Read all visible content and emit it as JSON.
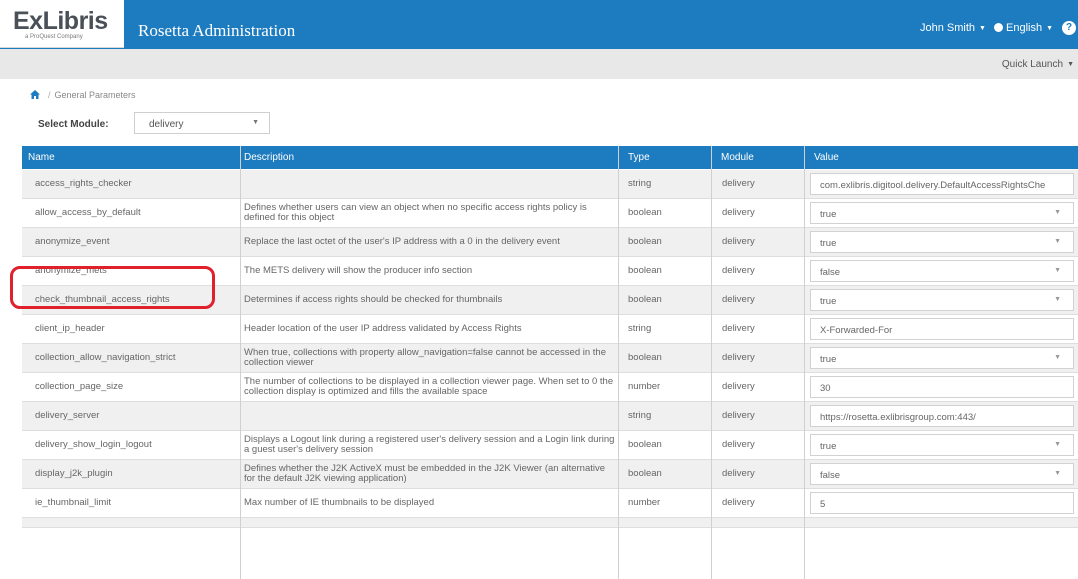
{
  "header": {
    "logo_text": "ExLibris",
    "logo_subtitle": "a ProQuest Company",
    "app_title": "Rosetta Administration",
    "user_menu": "John Smith",
    "language_menu": "English",
    "help_label": "?"
  },
  "quick_launch": {
    "label": "Quick Launch"
  },
  "breadcrumb": {
    "page": "General Parameters"
  },
  "module_select": {
    "label": "Select Module:",
    "value": "delivery"
  },
  "table": {
    "columns": [
      "Name",
      "Description",
      "Type",
      "Module",
      "Value"
    ],
    "rows": [
      {
        "name": "access_rights_checker",
        "description": "",
        "type": "string",
        "module": "delivery",
        "value": "com.exlibris.digitool.delivery.DefaultAccessRightsChe",
        "control": "text"
      },
      {
        "name": "allow_access_by_default",
        "description": "Defines whether users can view an object when no specific access rights policy is defined for this object",
        "type": "boolean",
        "module": "delivery",
        "value": "true",
        "control": "select"
      },
      {
        "name": "anonymize_event",
        "description": "Replace the last octet of the user's IP address with a 0 in the delivery event",
        "type": "boolean",
        "module": "delivery",
        "value": "true",
        "control": "select"
      },
      {
        "name": "anonymize_mets",
        "description": "The METS delivery will show the producer info section",
        "type": "boolean",
        "module": "delivery",
        "value": "false",
        "control": "select"
      },
      {
        "name": "check_thumbnail_access_rights",
        "description": "Determines if access rights should be checked for thumbnails",
        "type": "boolean",
        "module": "delivery",
        "value": "true",
        "control": "select"
      },
      {
        "name": "client_ip_header",
        "description": "Header location of the user IP address validated by Access Rights",
        "type": "string",
        "module": "delivery",
        "value": "X-Forwarded-For",
        "control": "text"
      },
      {
        "name": "collection_allow_navigation_strict",
        "description": "When true, collections with property allow_navigation=false cannot be accessed in the collection viewer",
        "type": "boolean",
        "module": "delivery",
        "value": "true",
        "control": "select"
      },
      {
        "name": "collection_page_size",
        "description": "The number of collections to be displayed in a collection viewer page. When set to 0 the collection display is optimized and fills the available space",
        "type": "number",
        "module": "delivery",
        "value": "30",
        "control": "text"
      },
      {
        "name": "delivery_server",
        "description": "",
        "type": "string",
        "module": "delivery",
        "value": "https://rosetta.exlibrisgroup.com:443/",
        "control": "text"
      },
      {
        "name": "delivery_show_login_logout",
        "description": "Displays a Logout link during a registered user's delivery session and a Login link during a guest user's delivery session",
        "type": "boolean",
        "module": "delivery",
        "value": "true",
        "control": "select"
      },
      {
        "name": "display_j2k_plugin",
        "description": "Defines whether the J2K ActiveX must be embedded in the J2K Viewer (an alternative for the default J2K viewing application)",
        "type": "boolean",
        "module": "delivery",
        "value": "false",
        "control": "select"
      },
      {
        "name": "ie_thumbnail_limit",
        "description": "Max number of IE thumbnails to be displayed",
        "type": "number",
        "module": "delivery",
        "value": "5",
        "control": "text"
      }
    ]
  },
  "colors": {
    "header_blue": "#1d7bbf",
    "highlight_red": "#e0202a"
  }
}
